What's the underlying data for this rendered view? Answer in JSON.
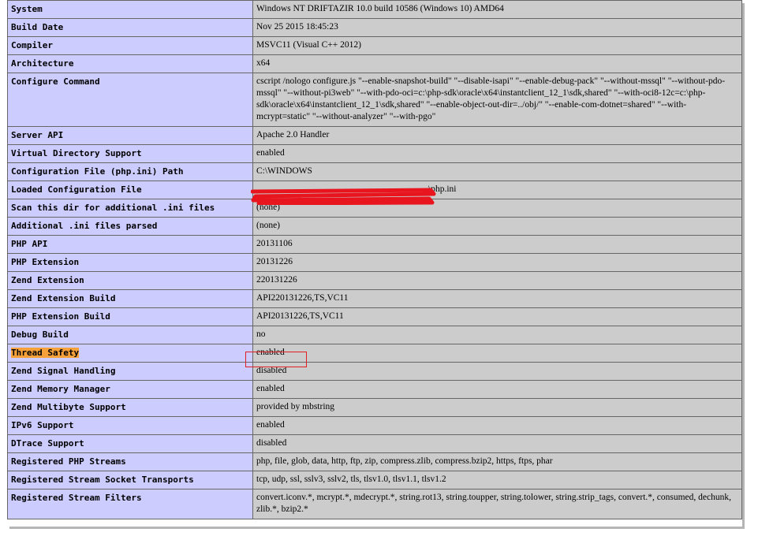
{
  "rows": [
    {
      "label": "System",
      "value": "Windows NT DRIFTAZIR 10.0 build 10586 (Windows 10) AMD64"
    },
    {
      "label": "Build Date",
      "value": "Nov 25 2015 18:45:23"
    },
    {
      "label": "Compiler",
      "value": "MSVC11 (Visual C++ 2012)"
    },
    {
      "label": "Architecture",
      "value": "x64"
    },
    {
      "label": "Configure Command",
      "value": "cscript /nologo configure.js \"--enable-snapshot-build\" \"--disable-isapi\" \"--enable-debug-pack\" \"--without-mssql\" \"--without-pdo-mssql\" \"--without-pi3web\" \"--with-pdo-oci=c:\\php-sdk\\oracle\\x64\\instantclient_12_1\\sdk,shared\" \"--with-oci8-12c=c:\\php-sdk\\oracle\\x64\\instantclient_12_1\\sdk,shared\" \"--enable-object-out-dir=../obj/\" \"--enable-com-dotnet=shared\" \"--with-mcrypt=static\" \"--without-analyzer\" \"--with-pgo\""
    },
    {
      "label": "Server API",
      "value": "Apache 2.0 Handler"
    },
    {
      "label": "Virtual Directory Support",
      "value": "enabled"
    },
    {
      "label": "Configuration File (php.ini) Path",
      "value": "C:\\WINDOWS"
    },
    {
      "label": "Loaded Configuration File",
      "value": "\\php.ini"
    },
    {
      "label": "Scan this dir for additional .ini files",
      "value": "(none)"
    },
    {
      "label": "Additional .ini files parsed",
      "value": "(none)"
    },
    {
      "label": "PHP API",
      "value": "20131106"
    },
    {
      "label": "PHP Extension",
      "value": "20131226"
    },
    {
      "label": "Zend Extension",
      "value": "220131226"
    },
    {
      "label": "Zend Extension Build",
      "value": "API220131226,TS,VC11"
    },
    {
      "label": "PHP Extension Build",
      "value": "API20131226,TS,VC11"
    },
    {
      "label": "Debug Build",
      "value": "no"
    },
    {
      "label": "Thread Safety",
      "value": "enabled"
    },
    {
      "label": "Zend Signal Handling",
      "value": "disabled"
    },
    {
      "label": "Zend Memory Manager",
      "value": "enabled"
    },
    {
      "label": "Zend Multibyte Support",
      "value": "provided by mbstring"
    },
    {
      "label": "IPv6 Support",
      "value": "enabled"
    },
    {
      "label": "DTrace Support",
      "value": "disabled"
    },
    {
      "label": "Registered PHP Streams",
      "value": "php, file, glob, data, http, ftp, zip, compress.zlib, compress.bzip2, https, ftps, phar"
    },
    {
      "label": "Registered Stream Socket Transports",
      "value": "tcp, udp, ssl, sslv3, sslv2, tls, tlsv1.0, tlsv1.1, tlsv1.2"
    },
    {
      "label": "Registered Stream Filters",
      "value": "convert.iconv.*, mcrypt.*, mdecrypt.*, string.rot13, string.toupper, string.tolower, string.strip_tags, convert.*, consumed, dechunk, zlib.*, bzip2.*"
    }
  ],
  "colors": {
    "label_bg": "#ccccff",
    "value_bg": "#cccccc",
    "highlight": "#f7a13a",
    "annotation_box": "#e02020",
    "redaction": "#e8141e"
  }
}
